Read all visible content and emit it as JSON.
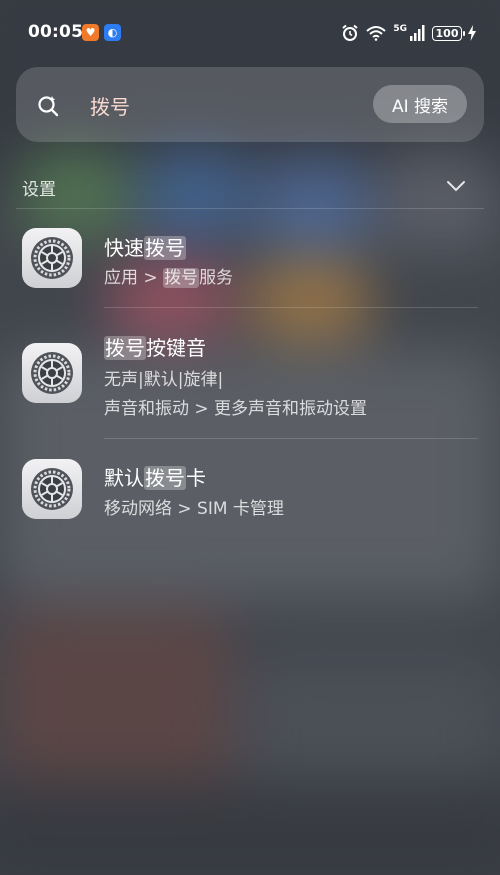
{
  "status_bar": {
    "time": "00:05",
    "app_icon_1": "browser-app-icon",
    "app_icon_2": "blue-app-icon",
    "network": "5G",
    "wifi_sub": "6",
    "battery": "100"
  },
  "search": {
    "query": "拨号",
    "ai_button": "AI 搜索"
  },
  "section": {
    "title": "设置"
  },
  "results": [
    {
      "title_pre": "快速",
      "title_hl": "拨号",
      "title_post": "",
      "sub1_pre": "应用 > ",
      "sub1_hl": "拨号",
      "sub1_post": "服务",
      "sub2": ""
    },
    {
      "title_pre": "",
      "title_hl": "拨号",
      "title_post": "按键音",
      "sub1_pre": "无声|默认|旋律|",
      "sub1_hl": "",
      "sub1_post": "",
      "sub2": "声音和振动 > 更多声音和振动设置"
    },
    {
      "title_pre": "默认",
      "title_hl": "拨号",
      "title_post": "卡",
      "sub1_pre": "移动网络 > SIM 卡管理",
      "sub1_hl": "",
      "sub1_post": "",
      "sub2": ""
    }
  ],
  "icons": {
    "result_icon": "settings-gear-icon"
  },
  "colors": {
    "query_text": "#f6d8cf",
    "background": "#4a4e55"
  }
}
